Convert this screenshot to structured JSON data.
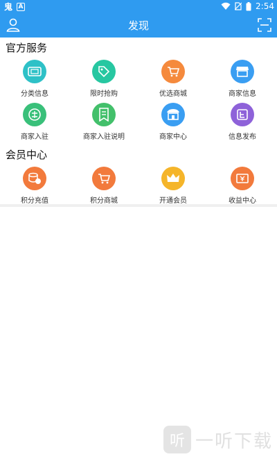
{
  "status_bar": {
    "time": "2:54",
    "left_glyph": "鬼",
    "left_badge": "A"
  },
  "app_bar": {
    "title": "发现"
  },
  "sections": [
    {
      "title": "官方服务",
      "items": [
        {
          "label": "分类信息",
          "icon": "ticket-icon",
          "color": "#2ec1c7"
        },
        {
          "label": "限时抢购",
          "icon": "tag-icon",
          "color": "#27c7a1"
        },
        {
          "label": "优选商城",
          "icon": "cart-icon",
          "color": "#f58a3d"
        },
        {
          "label": "商家信息",
          "icon": "shop-icon",
          "color": "#3a9ef2"
        },
        {
          "label": "商家入驻",
          "icon": "stamp-icon",
          "color": "#39c07a"
        },
        {
          "label": "商家入驻说明",
          "icon": "document-icon",
          "color": "#43c06b"
        },
        {
          "label": "商家中心",
          "icon": "store-icon",
          "color": "#3a9ef2"
        },
        {
          "label": "信息发布",
          "icon": "publish-icon",
          "color": "#8e62d9"
        }
      ]
    },
    {
      "title": "会员中心",
      "items": [
        {
          "label": "积分充值",
          "icon": "coins-icon",
          "color": "#f27a3c"
        },
        {
          "label": "积分商城",
          "icon": "cart-icon",
          "color": "#f27a3c"
        },
        {
          "label": "开通会员",
          "icon": "crown-icon",
          "color": "#f5b52a"
        },
        {
          "label": "收益中心",
          "icon": "earnings-icon",
          "color": "#f27a3c"
        }
      ]
    }
  ],
  "watermark": {
    "logo": "听",
    "text": "一听下载"
  }
}
